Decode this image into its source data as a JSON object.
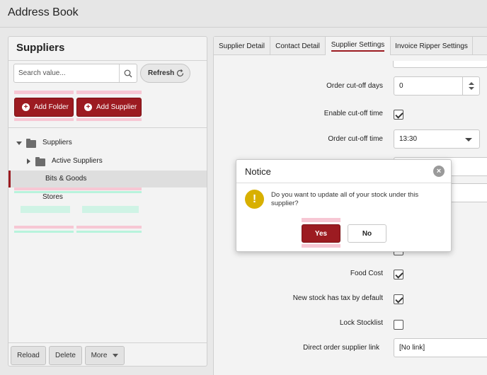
{
  "app": {
    "title": "Address Book"
  },
  "left": {
    "title": "Suppliers",
    "search": {
      "placeholder": "Search value...",
      "value": ""
    },
    "refresh_label": "Refresh",
    "add_folder_label": "Add Folder",
    "add_supplier_label": "Add Supplier",
    "tree": {
      "root": "Suppliers",
      "active": "Active Suppliers",
      "selected": "Bits & Goods",
      "stores": "Stores"
    },
    "footer": {
      "reload": "Reload",
      "delete": "Delete",
      "more": "More"
    }
  },
  "right": {
    "tabs": [
      {
        "label": "Supplier Detail"
      },
      {
        "label": "Contact Detail"
      },
      {
        "label": "Supplier Settings"
      },
      {
        "label": "Invoice Ripper Settings"
      }
    ],
    "fields": {
      "cutoff_days_label": "Order cut-off days",
      "cutoff_days_value": "0",
      "enable_cutoff_label": "Enable cut-off time",
      "cutoff_time_label": "Order cut-off time",
      "cutoff_time_value": "13:30",
      "food_cost_label": "Food Cost",
      "new_stock_tax_label": "New stock has tax by default",
      "lock_stocklist_label": "Lock Stocklist",
      "direct_order_label": "Direct order supplier link",
      "direct_order_value": "[No link]"
    }
  },
  "modal": {
    "title": "Notice",
    "message": "Do you want to update all of your stock under this supplier?",
    "yes_label": "Yes",
    "no_label": "No"
  },
  "colors": {
    "accent": "#9c1b21"
  }
}
